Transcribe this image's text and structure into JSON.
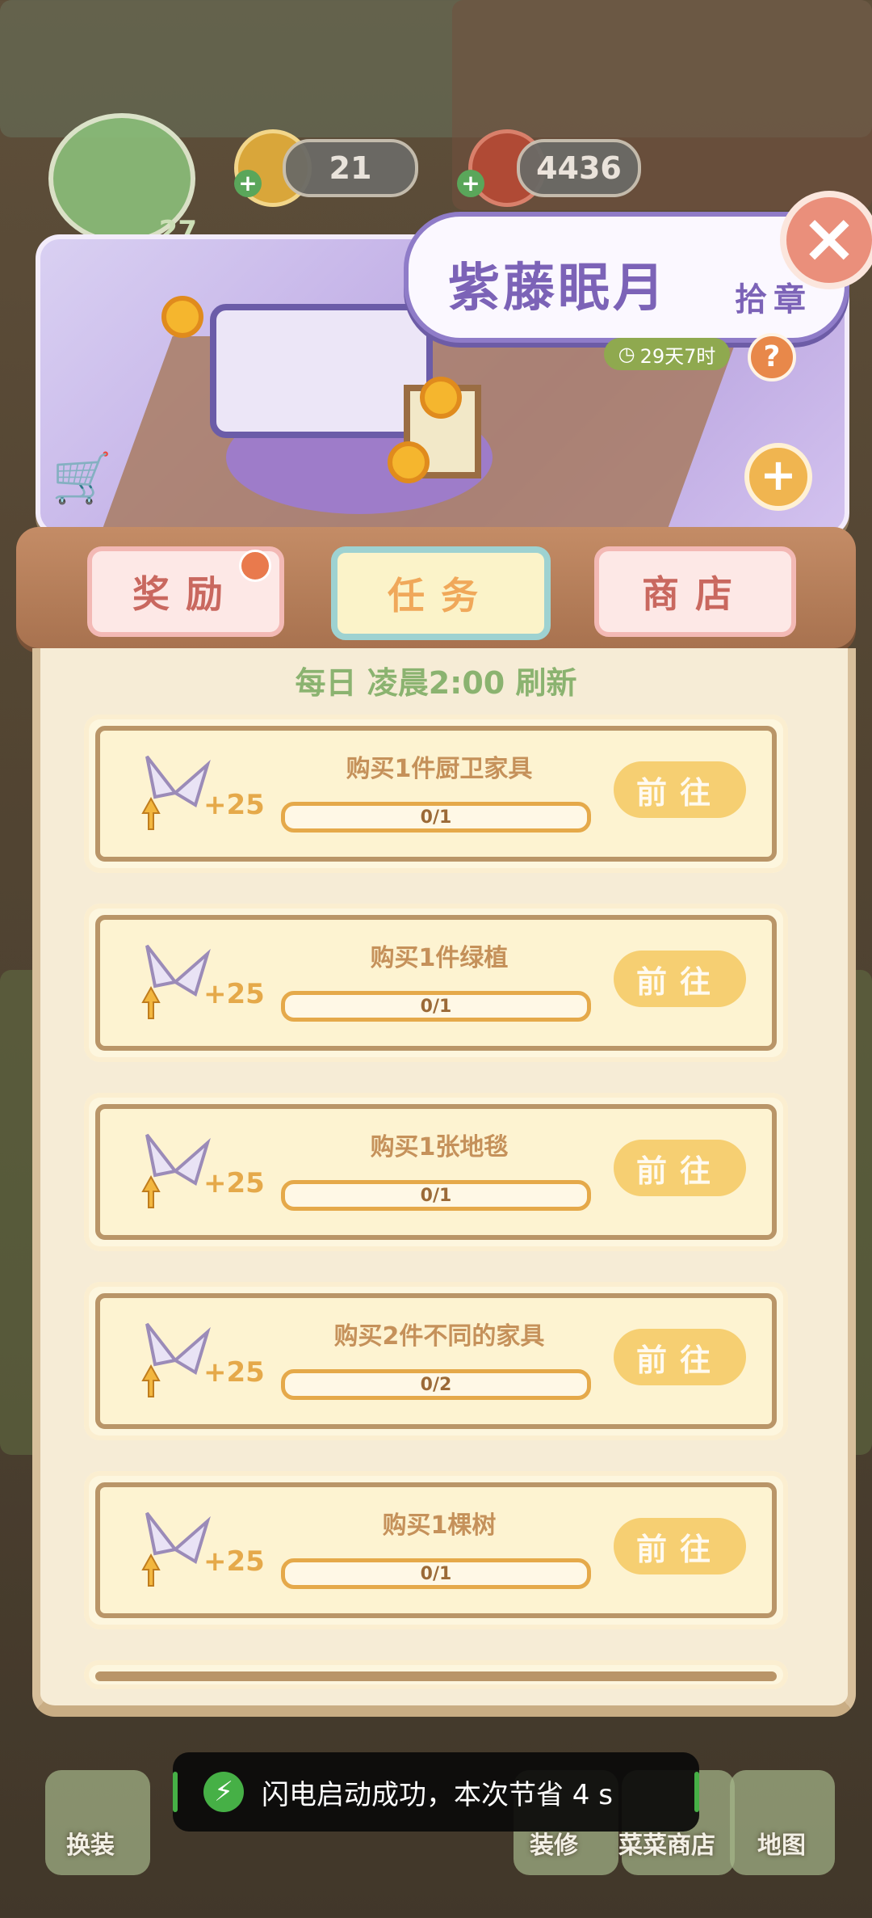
{
  "hud": {
    "level": "27",
    "coins": "21",
    "berries": "4436"
  },
  "banner": {
    "title": "紫藤眠月",
    "chapter": "拾章",
    "timer": "29天7时",
    "help_icon": "question-icon",
    "close_icon": "close-icon"
  },
  "tabs": [
    {
      "label": "奖励",
      "active": false
    },
    {
      "label": "任务",
      "active": true
    },
    {
      "label": "商店",
      "active": false
    }
  ],
  "refresh_text": "每日 凌晨2:00 刷新",
  "tasks": [
    {
      "name": "购买1件厨卫家具",
      "progress": "0/1",
      "reward": "+25",
      "button": "前往"
    },
    {
      "name": "购买1件绿植",
      "progress": "0/1",
      "reward": "+25",
      "button": "前往"
    },
    {
      "name": "购买1张地毯",
      "progress": "0/1",
      "reward": "+25",
      "button": "前往"
    },
    {
      "name": "购买2件不同的家具",
      "progress": "0/2",
      "reward": "+25",
      "button": "前往"
    },
    {
      "name": "购买1棵树",
      "progress": "0/1",
      "reward": "+25",
      "button": "前往"
    }
  ],
  "bottom_nav": {
    "dress": "换装",
    "decorate": "装修",
    "shop": "菜菜商店",
    "map": "地图"
  },
  "toast": "闪电启动成功，本次节省 4 s"
}
